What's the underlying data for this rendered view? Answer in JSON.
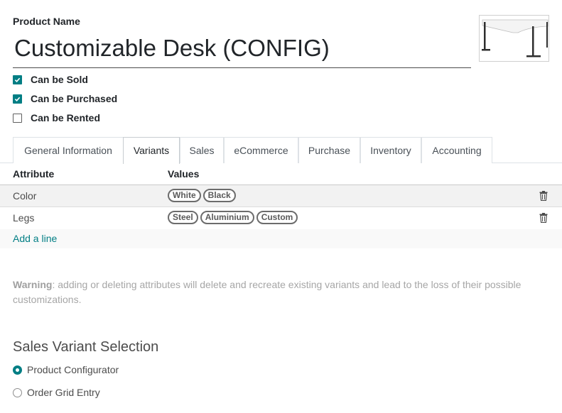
{
  "form": {
    "product_name_label": "Product Name",
    "product_name": "Customizable Desk (CONFIG)",
    "product_image_alt": "desk-image"
  },
  "checkboxes": [
    {
      "label": "Can be Sold",
      "checked": true
    },
    {
      "label": "Can be Purchased",
      "checked": true
    },
    {
      "label": "Can be Rented",
      "checked": false
    }
  ],
  "tabs": [
    {
      "label": "General Information"
    },
    {
      "label": "Variants",
      "active": true
    },
    {
      "label": "Sales"
    },
    {
      "label": "eCommerce"
    },
    {
      "label": "Purchase"
    },
    {
      "label": "Inventory"
    },
    {
      "label": "Accounting"
    }
  ],
  "table": {
    "headers": {
      "attribute": "Attribute",
      "values": "Values"
    },
    "rows": [
      {
        "attribute": "Color",
        "values": [
          "White",
          "Black"
        ]
      },
      {
        "attribute": "Legs",
        "values": [
          "Steel",
          "Aluminium",
          "Custom"
        ]
      }
    ],
    "add_line": "Add a line"
  },
  "warning": {
    "prefix": "Warning",
    "text": ": adding or deleting attributes will delete and recreate existing variants and lead to the loss of their possible customizations."
  },
  "sales_variant": {
    "title": "Sales Variant Selection",
    "options": [
      {
        "label": "Product Configurator",
        "selected": true
      },
      {
        "label": "Order Grid Entry",
        "selected": false
      }
    ]
  },
  "colors": {
    "accent": "#017e84"
  },
  "icons": {
    "checkmark": "check-icon",
    "delete": "trash-icon"
  }
}
